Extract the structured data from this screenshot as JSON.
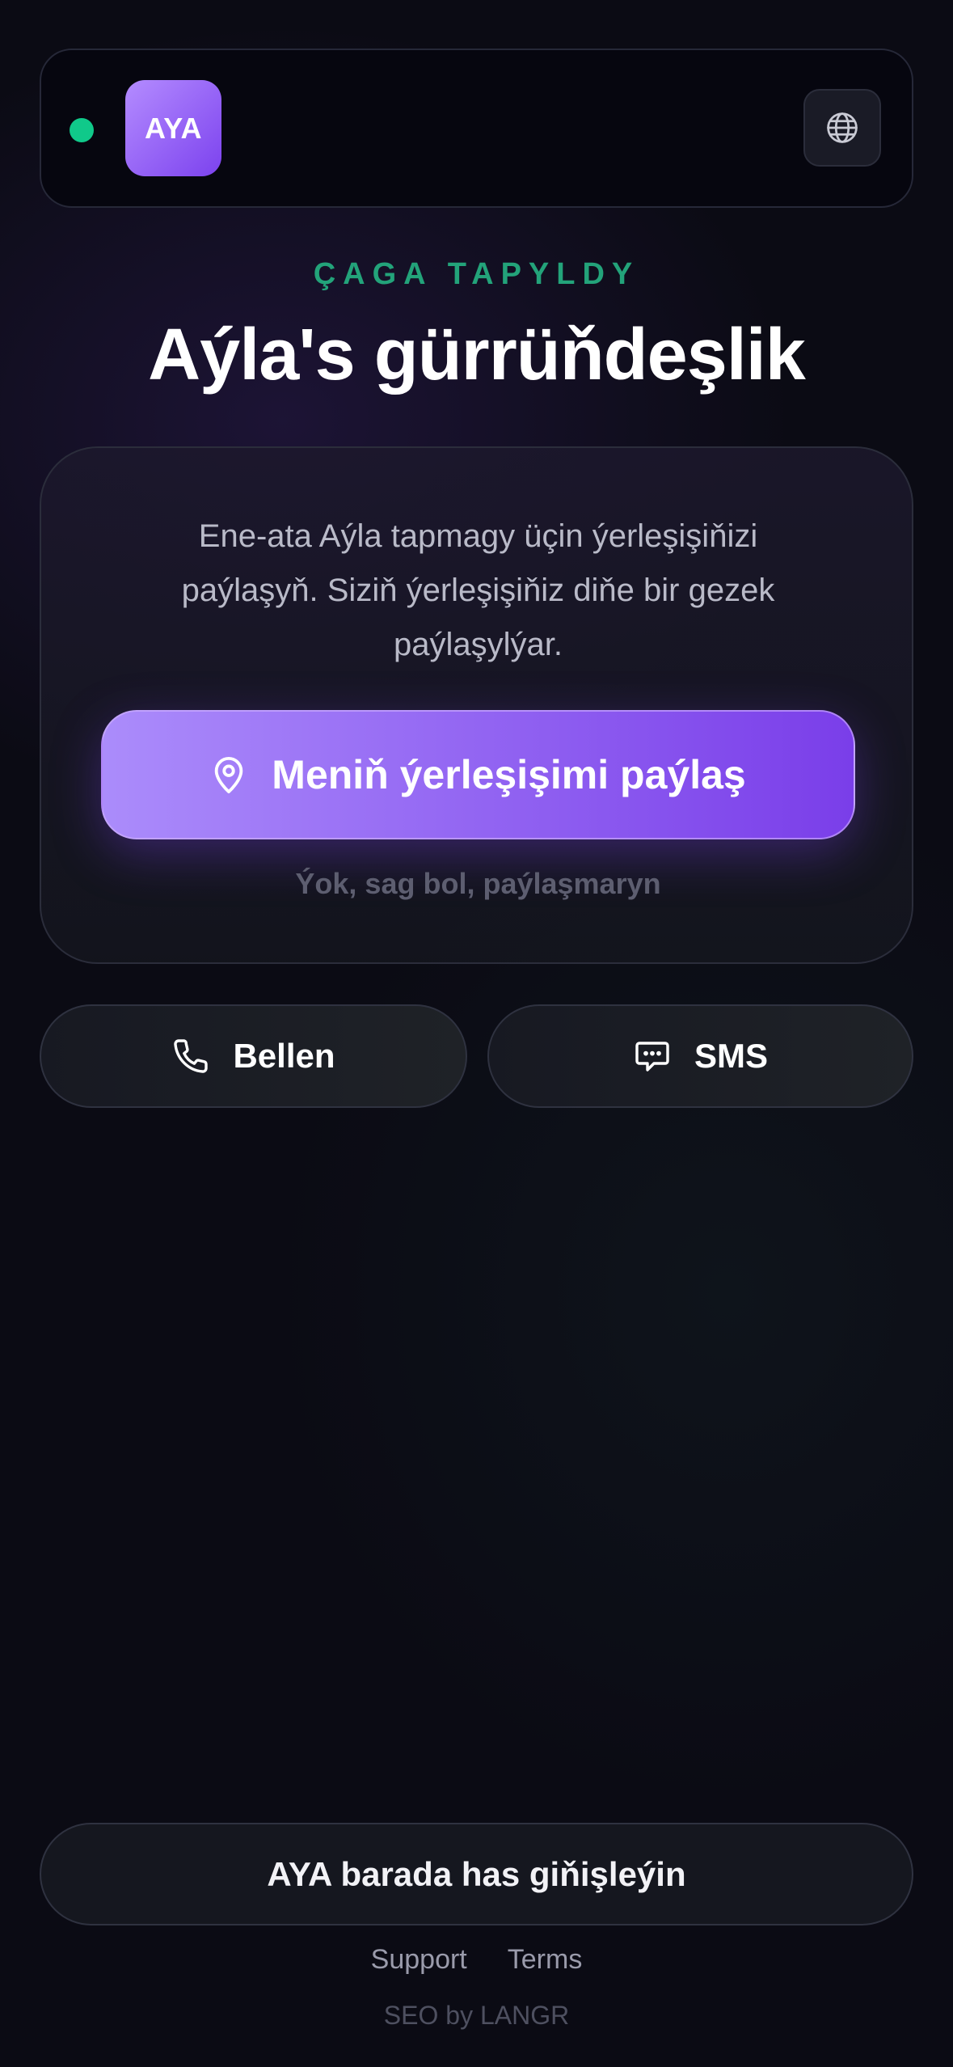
{
  "header": {
    "logo_text": "AYA",
    "status_color": "#10c98a",
    "language_icon": "globe-icon"
  },
  "hero": {
    "eyebrow": "ÇAGA TAPYLDY",
    "title": "Aýla's gürrüňdeşlik"
  },
  "card": {
    "description": "Ene-ata Aýla tapmagy üçin ýerleşişiňizi paýlaşyň. Siziň ýerleşişiňiz diňe bir gezek paýlaşylýar.",
    "share_button_label": "Meniň ýerleşişimi paýlaş",
    "share_icon": "location-pin-icon",
    "decline_label": "Ýok, sag bol, paýlaşmaryn"
  },
  "actions": {
    "call_label": "Bellen",
    "call_icon": "phone-icon",
    "sms_label": "SMS",
    "sms_icon": "chat-bubble-icon"
  },
  "footer": {
    "learn_more_label": "AYA barada has giňişleýin",
    "links": [
      "Support",
      "Terms"
    ],
    "credit": "SEO by LANGR"
  },
  "colors": {
    "accent_start": "#ab8cfb",
    "accent_end": "#7a3ee9",
    "success": "#10c98a",
    "background": "#0b0b14"
  }
}
